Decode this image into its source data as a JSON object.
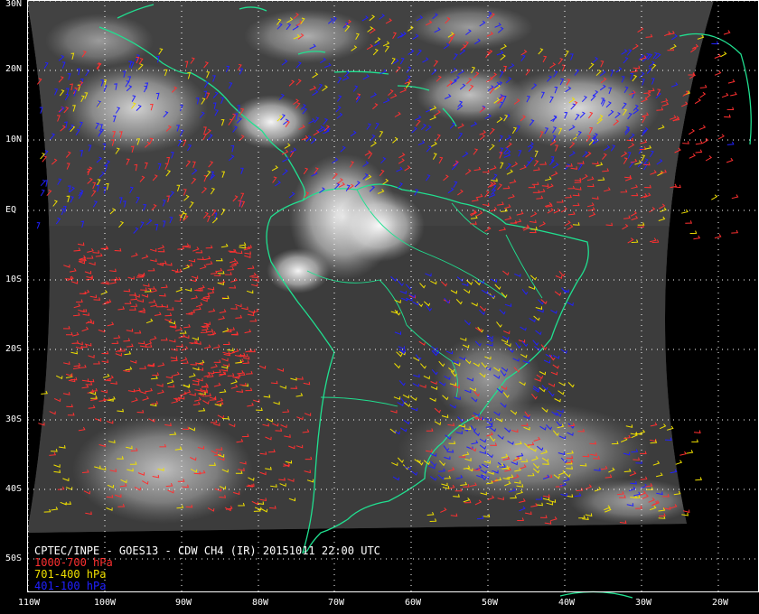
{
  "caption": {
    "title": "CPTEC/INPE - GOES13 - CDW CH4 (IR) 20151011 22:00 UTC",
    "legend": [
      {
        "label": "1000-700 hPa",
        "color": "#ff3030"
      },
      {
        "label": "701-400 hPa",
        "color": "#f0e000"
      },
      {
        "label": "401-100 hPa",
        "color": "#2020ff"
      }
    ]
  },
  "grid": {
    "lat_labels": [
      "30N",
      "20N",
      "10N",
      "EQ",
      "10S",
      "20S",
      "30S",
      "40S",
      "50S"
    ],
    "lon_labels": [
      "110W",
      "100W",
      "90W",
      "80W",
      "70W",
      "60W",
      "50W",
      "40W",
      "30W",
      "20W"
    ]
  },
  "colors": {
    "coastline": "#20e090",
    "gridline": "#ffffff",
    "background": "#000000"
  }
}
